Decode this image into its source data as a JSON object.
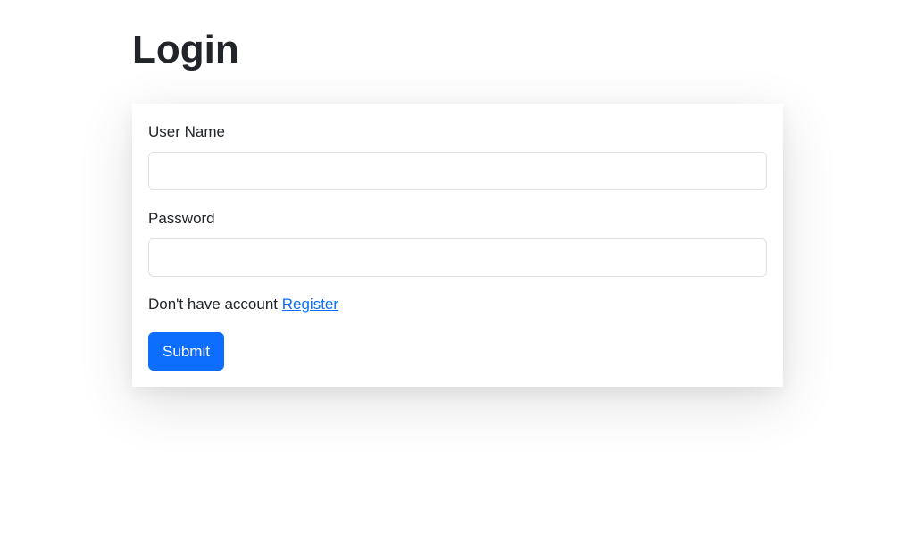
{
  "page": {
    "title": "Login"
  },
  "form": {
    "username": {
      "label": "User Name",
      "value": "",
      "placeholder": ""
    },
    "password": {
      "label": "Password",
      "value": "",
      "placeholder": ""
    },
    "account_prompt": "Don't have account",
    "register_link": "Register",
    "submit_label": "Submit"
  },
  "colors": {
    "primary": "#0d6efd",
    "text": "#212529",
    "input_border": "#dee2e6",
    "background": "#ffffff"
  }
}
